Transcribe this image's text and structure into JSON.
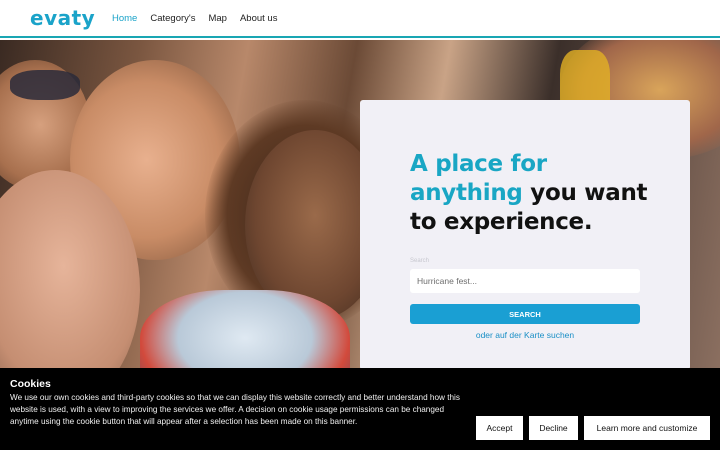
{
  "header": {
    "logo": "evaty",
    "nav": [
      {
        "label": "Home",
        "active": true
      },
      {
        "label": "Category's",
        "active": false
      },
      {
        "label": "Map",
        "active": false
      },
      {
        "label": "About us",
        "active": false
      }
    ]
  },
  "hero": {
    "headline_accent_1": "A place for",
    "headline_accent_2": "anything",
    "headline_rest_1": "you want",
    "headline_rest_2": "to experience",
    "headline_period": ".",
    "search_label": "Search",
    "search_placeholder": "Hurricane fest...",
    "search_button": "SEARCH",
    "map_link": "oder auf der Karte suchen"
  },
  "cookie_banner": {
    "title": "Cookies",
    "text": "We use our own cookies and third-party cookies so that we can display this website correctly and better understand how this website is used, with a view to improving the services we offer. A decision on cookie usage permissions can be changed anytime using the cookie button that will appear after a selection has been made on this banner.",
    "accept": "Accept",
    "decline": "Decline",
    "learn_more": "Learn more and customize"
  },
  "colors": {
    "brand": "#1aa3c9",
    "accent": "#19a6c4",
    "button": "#1a9fd3"
  }
}
